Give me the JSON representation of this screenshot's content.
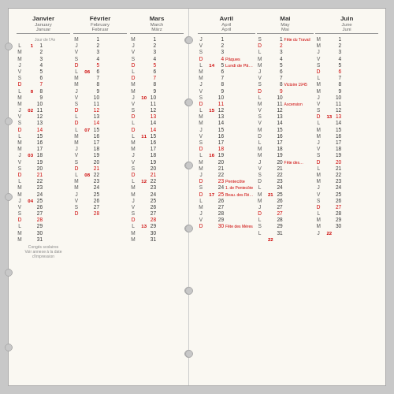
{
  "months": {
    "janvier": {
      "fr": "Janvier",
      "en": "January",
      "de": "Januar"
    },
    "fevrier": {
      "fr": "Février",
      "en": "February",
      "de": "Februar"
    },
    "mars": {
      "fr": "Mars",
      "en": "March",
      "de": "März"
    },
    "avril": {
      "fr": "Avril",
      "en": "April",
      "de": "April"
    },
    "mai": {
      "fr": "Mai",
      "en": "May",
      "de": "Mai"
    },
    "juin": {
      "fr": "Juin",
      "en": "June",
      "de": "Juni"
    }
  },
  "footer": "Congés scolaires\nVoir annexe à la date d'impression"
}
